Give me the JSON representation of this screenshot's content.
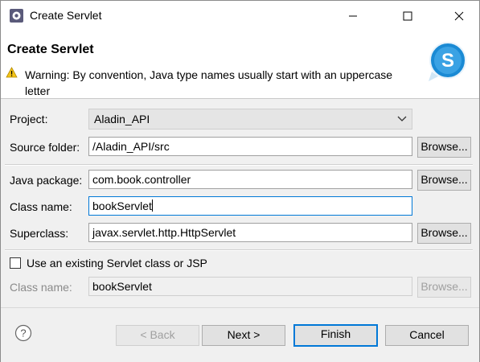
{
  "window": {
    "title": "Create Servlet",
    "icon": "eclipse-gear-icon",
    "controls": [
      "minimize-icon",
      "maximize-icon",
      "close-icon"
    ]
  },
  "banner": {
    "title": "Create Servlet",
    "warning": "Warning: By convention, Java type names usually start with an uppercase letter",
    "logo": "servlet-s-logo-icon"
  },
  "form": {
    "project": {
      "label": "Project:",
      "value": "Aladin_API"
    },
    "source_folder": {
      "label": "Source folder:",
      "value": "/Aladin_API/src",
      "browse": "Browse..."
    },
    "java_package": {
      "label": "Java package:",
      "value": "com.book.controller",
      "browse": "Browse..."
    },
    "class_name": {
      "label": "Class name:",
      "value": "bookServlet"
    },
    "superclass": {
      "label": "Superclass:",
      "value": "javax.servlet.http.HttpServlet",
      "browse": "Browse..."
    },
    "use_existing": {
      "label": "Use an existing Servlet class or JSP",
      "checked": false
    },
    "existing_class_name": {
      "label": "Class name:",
      "value": "bookServlet",
      "browse": "Browse..."
    }
  },
  "buttons": {
    "back": "< Back",
    "next": "Next >",
    "finish": "Finish",
    "cancel": "Cancel"
  },
  "colors": {
    "focus_border": "#0078d7",
    "warning_yellow": "#f5c518",
    "logo_blue": "#1a8ad4"
  }
}
